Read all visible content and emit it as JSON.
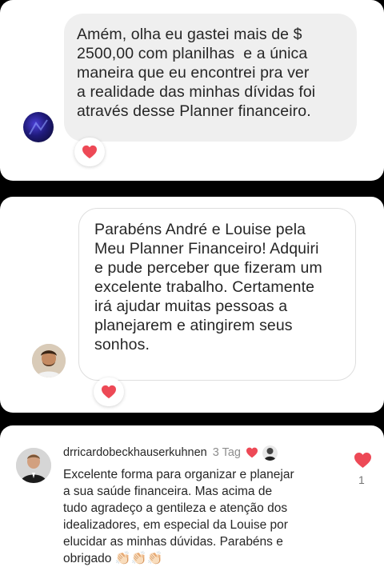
{
  "colors": {
    "heart": "#ed4956",
    "bubble_gray": "#efefef",
    "text": "#262626",
    "muted": "#8e8e8e"
  },
  "message1": {
    "lines": [
      "Amém, olha eu gastei mais de $",
      "2500,00 com planilhas  e a única",
      "maneira que eu encontrei pra ver",
      "a realidade das minhas dívidas foi",
      "através desse Planner financeiro."
    ],
    "reaction_icon": "heart-icon"
  },
  "message2": {
    "lines": [
      "Parabéns André e Louise pela",
      "Meu Planner Financeiro! Adquiri",
      "e pude perceber que fizeram um",
      "excelente trabalho. Certamente",
      "irá ajudar muitas pessoas a",
      "planejarem e atingirem seus",
      "sonhos."
    ],
    "reaction_icon": "heart-icon"
  },
  "comment": {
    "username": "drricardobeckhauserkuhnen",
    "time": "3 Tag",
    "lines": [
      "Excelente forma para organizar e planejar",
      "a sua saúde financeira. Mas acima de",
      "tudo agradeço a gentileza e atenção dos",
      "idealizadores, em especial da Louise por",
      "elucidar as minhas dúvidas. Parabéns e",
      "obrigado"
    ],
    "emoji": "👏🏻👏🏻👏🏻",
    "likes": "1",
    "like_icon": "heart-icon"
  }
}
